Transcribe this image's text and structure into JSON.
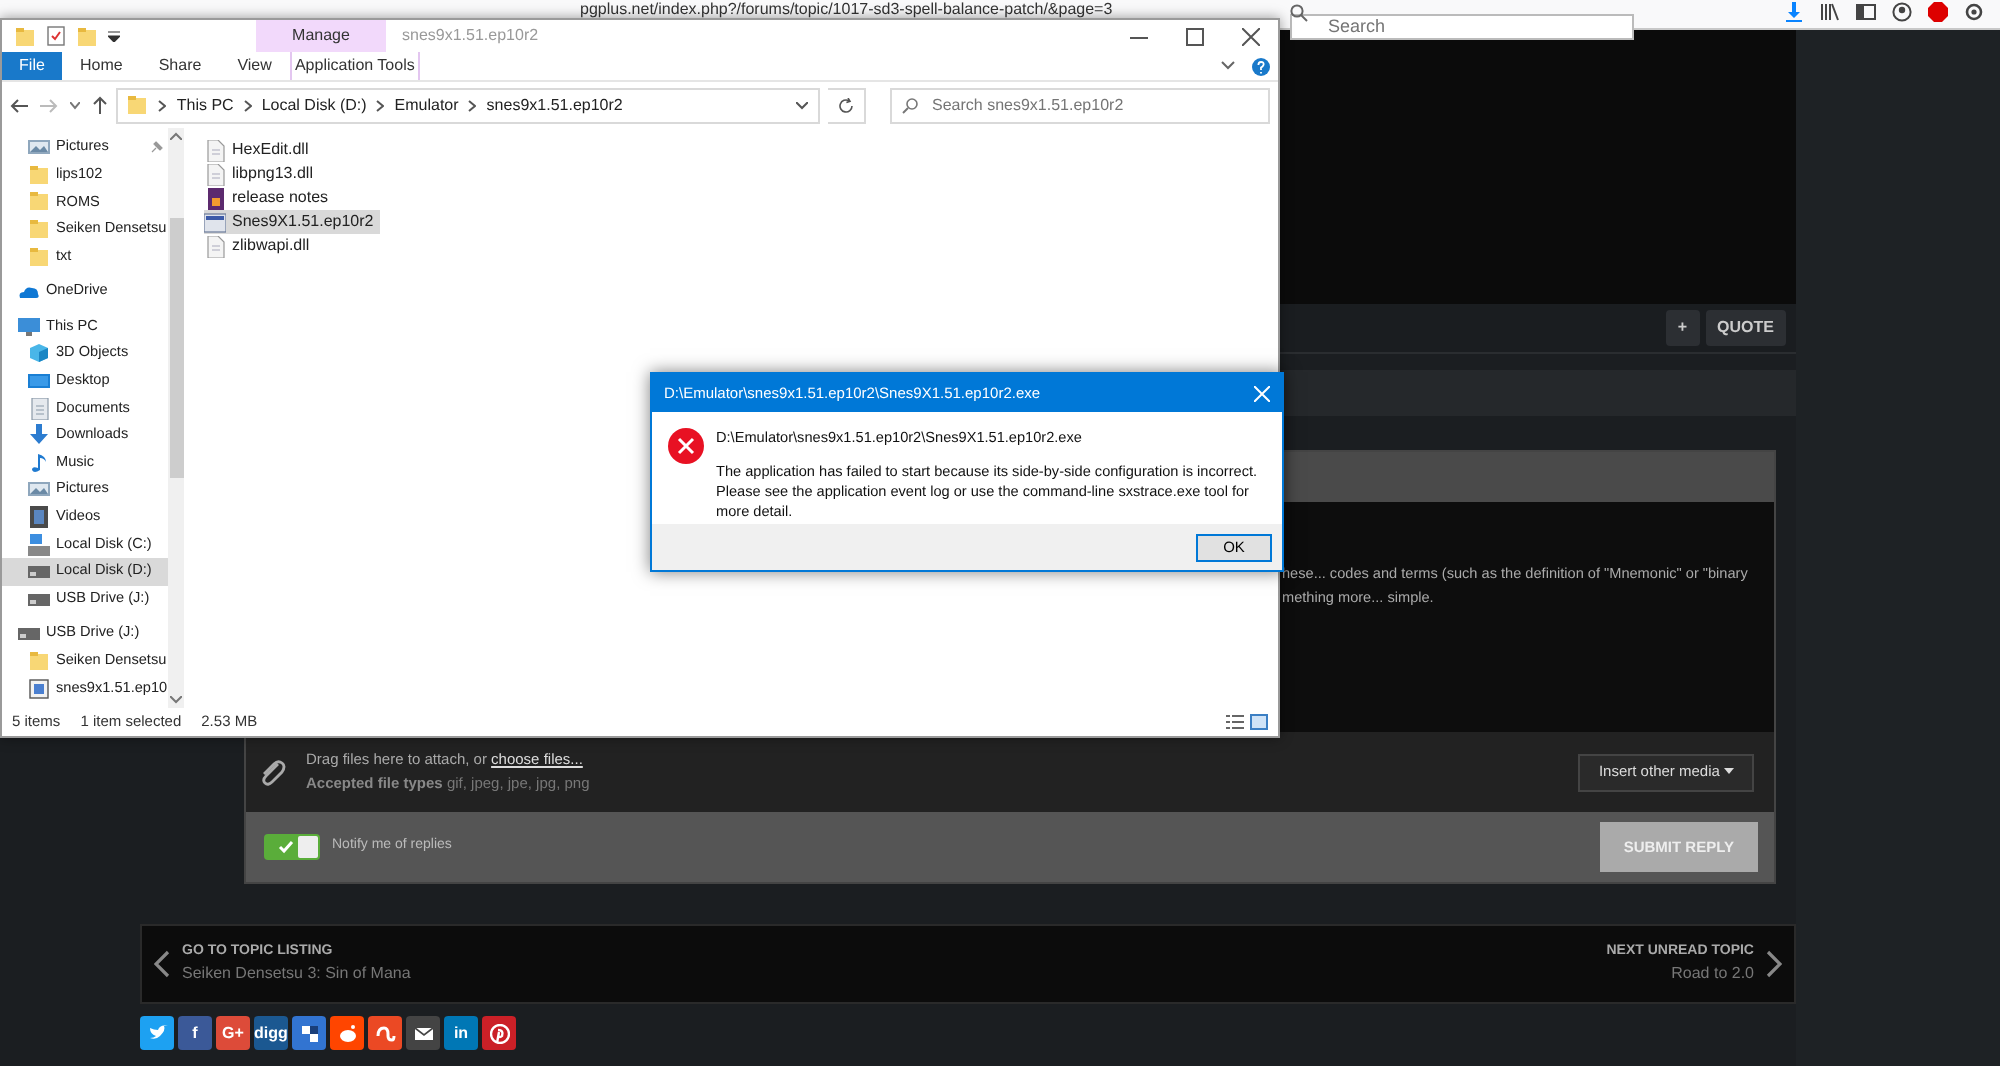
{
  "browser": {
    "url": "pgplus.net/index.php?/forums/topic/1017-sd3-spell-balance-patch/&page=3",
    "search": {
      "placeholder": "Search"
    }
  },
  "explorer": {
    "title": "snes9x1.51.ep10r2",
    "context_group": "Manage",
    "ribbon_tabs": [
      {
        "label": "File",
        "kind": "file",
        "selected": false
      },
      {
        "label": "Home",
        "kind": "tab",
        "selected": false
      },
      {
        "label": "Share",
        "kind": "tab",
        "selected": false
      },
      {
        "label": "View",
        "kind": "tab",
        "selected": false
      },
      {
        "label": "Application Tools",
        "kind": "context",
        "selected": false
      }
    ],
    "breadcrumbs": [
      "This PC",
      "Local Disk (D:)",
      "Emulator",
      "snes9x1.51.ep10r2"
    ],
    "search": {
      "placeholder": "Search snes9x1.51.ep10r2"
    },
    "quick_access": [
      {
        "label": "Pictures",
        "kind": "pictures",
        "pinned": true,
        "selected": false
      },
      {
        "label": "lips102",
        "kind": "folder",
        "pinned": false,
        "selected": false
      },
      {
        "label": "ROMS",
        "kind": "folder",
        "pinned": false,
        "selected": false
      },
      {
        "label": "Seiken Densetsu",
        "kind": "folder",
        "pinned": false,
        "selected": false
      },
      {
        "label": "txt",
        "kind": "folder",
        "pinned": false,
        "selected": false
      }
    ],
    "nav": [
      {
        "label": "OneDrive",
        "kind": "onedrive",
        "selected": false
      },
      {
        "label": "This PC",
        "kind": "pc",
        "selected": false,
        "children": [
          {
            "label": "3D Objects",
            "kind": "objects",
            "selected": false
          },
          {
            "label": "Desktop",
            "kind": "desktop",
            "selected": false
          },
          {
            "label": "Documents",
            "kind": "documents",
            "selected": false
          },
          {
            "label": "Downloads",
            "kind": "downloads",
            "selected": false
          },
          {
            "label": "Music",
            "kind": "music",
            "selected": false
          },
          {
            "label": "Pictures",
            "kind": "pictures",
            "selected": false
          },
          {
            "label": "Videos",
            "kind": "videos",
            "selected": false
          },
          {
            "label": "Local Disk (C:)",
            "kind": "system",
            "selected": false
          },
          {
            "label": "Local Disk (D:)",
            "kind": "disk",
            "selected": true
          },
          {
            "label": "USB Drive (J:)",
            "kind": "disk",
            "selected": false
          }
        ]
      },
      {
        "label": "USB Drive (J:)",
        "kind": "disk",
        "selected": false,
        "children": [
          {
            "label": "Seiken Densetsu",
            "kind": "folder",
            "selected": false
          },
          {
            "label": "snes9x1.51.ep10",
            "kind": "shortcut",
            "selected": false
          }
        ]
      }
    ],
    "files": [
      {
        "name": "HexEdit.dll",
        "kind": "dll",
        "selected": false
      },
      {
        "name": "libpng13.dll",
        "kind": "dll",
        "selected": false
      },
      {
        "name": "release notes",
        "kind": "notes",
        "selected": false
      },
      {
        "name": "Snes9X1.51.ep10r2",
        "kind": "exe",
        "selected": true
      },
      {
        "name": "zlibwapi.dll",
        "kind": "dll",
        "selected": false
      }
    ],
    "status": {
      "count": "5 items",
      "selection": "1 item selected",
      "size": "2.53 MB"
    }
  },
  "dialog": {
    "title": "D:\\Emulator\\snes9x1.51.ep10r2\\Snes9X1.51.ep10r2.exe",
    "path": "D:\\Emulator\\snes9x1.51.ep10r2\\Snes9X1.51.ep10r2.exe",
    "message": "The application has failed to start because its side-by-side configuration is incorrect. Please see the application event log or use the command-line sxstrace.exe tool for more detail.",
    "button": "OK"
  },
  "forum": {
    "post_buttons": [
      "+",
      "QUOTE"
    ],
    "post_lines": [
      "hese... codes and terms (such as the definition of \"Mnemonic\" or \"binary",
      "mething more... simple."
    ],
    "attach": {
      "text": "Drag files here to attach, or ",
      "link": "choose files...",
      "types_label": "Accepted file types",
      "types": "gif, jpeg, jpe, jpg, png"
    },
    "insert_media": "Insert other media",
    "notify": {
      "label": "Notify me of replies",
      "on": true
    },
    "submit": {
      "label": "SUBMIT REPLY",
      "disabled": true
    },
    "prev": {
      "label": "GO TO TOPIC LISTING",
      "title": "Seiken Densetsu 3: Sin of Mana"
    },
    "next": {
      "label": "NEXT UNREAD TOPIC",
      "title": "Road to 2.0"
    },
    "share": [
      {
        "kind": "twitter",
        "color": "#1da1f2"
      },
      {
        "kind": "text",
        "glyph": "f",
        "color": "#3b5998"
      },
      {
        "kind": "text",
        "glyph": "G+",
        "color": "#dd4b39"
      },
      {
        "kind": "text",
        "glyph": "digg",
        "color": "#1b5891"
      },
      {
        "kind": "delicious",
        "color": "#3274d1"
      },
      {
        "kind": "reddit",
        "color": "#ff4500"
      },
      {
        "kind": "stumble",
        "color": "#eb4924"
      },
      {
        "kind": "email",
        "color": "#444444"
      },
      {
        "kind": "text",
        "glyph": "in",
        "color": "#0077b5"
      },
      {
        "kind": "pinterest",
        "color": "#cb2027"
      }
    ]
  }
}
